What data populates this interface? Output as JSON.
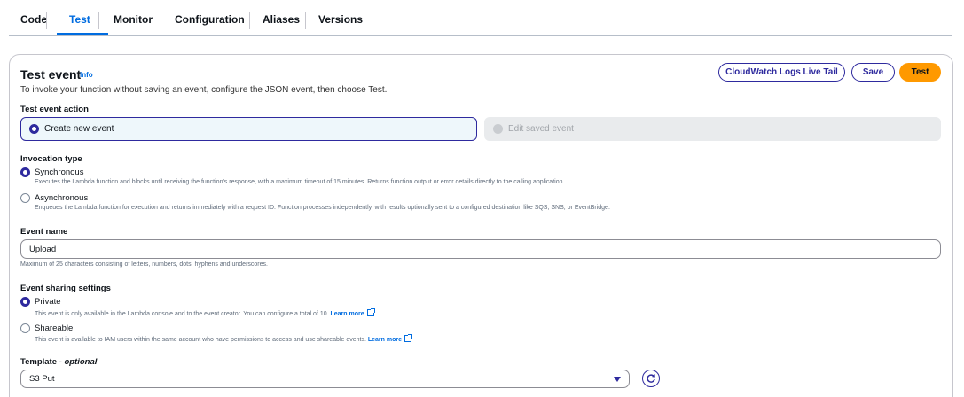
{
  "tabs": [
    {
      "label": "Code"
    },
    {
      "label": "Test"
    },
    {
      "label": "Monitor"
    },
    {
      "label": "Configuration"
    },
    {
      "label": "Aliases"
    },
    {
      "label": "Versions"
    }
  ],
  "active_tab": "Test",
  "header": {
    "title": "Test event",
    "info": "Info",
    "description": "To invoke your function without saving an event, configure the JSON event, then choose Test."
  },
  "buttons": {
    "live_tail": "CloudWatch Logs Live Tail",
    "save": "Save",
    "test": "Test"
  },
  "test_event_action": {
    "label": "Test event action",
    "options": [
      {
        "label": "Create new event",
        "state": "selected"
      },
      {
        "label": "Edit saved event",
        "state": "disabled"
      }
    ]
  },
  "invocation_type": {
    "label": "Invocation type",
    "options": [
      {
        "label": "Synchronous",
        "selected": true,
        "description": "Executes the Lambda function and blocks until receiving the function's response, with a maximum timeout of 15 minutes. Returns function output or error details directly to the calling application."
      },
      {
        "label": "Asynchronous",
        "selected": false,
        "description": "Enqueues the Lambda function for execution and returns immediately with a request ID. Function processes independently, with results optionally sent to a configured destination like SQS, SNS, or EventBridge."
      }
    ]
  },
  "event_name": {
    "label": "Event name",
    "value": "Upload",
    "hint": "Maximum of 25 characters consisting of letters, numbers, dots, hyphens and underscores."
  },
  "sharing": {
    "label": "Event sharing settings",
    "options": [
      {
        "label": "Private",
        "selected": true,
        "description": "This event is only available in the Lambda console and to the event creator. You can configure a total of 10.",
        "link": "Learn more"
      },
      {
        "label": "Shareable",
        "selected": false,
        "description": "This event is available to IAM users within the same account who have permissions to access and use shareable events.",
        "link": "Learn more"
      }
    ]
  },
  "template": {
    "label": "Template - ",
    "label_optional": "optional",
    "value": "S3 Put"
  },
  "colors": {
    "accent": "#2e2a9e",
    "primary_button": "#ff9900",
    "tab_active": "#006ce0"
  }
}
